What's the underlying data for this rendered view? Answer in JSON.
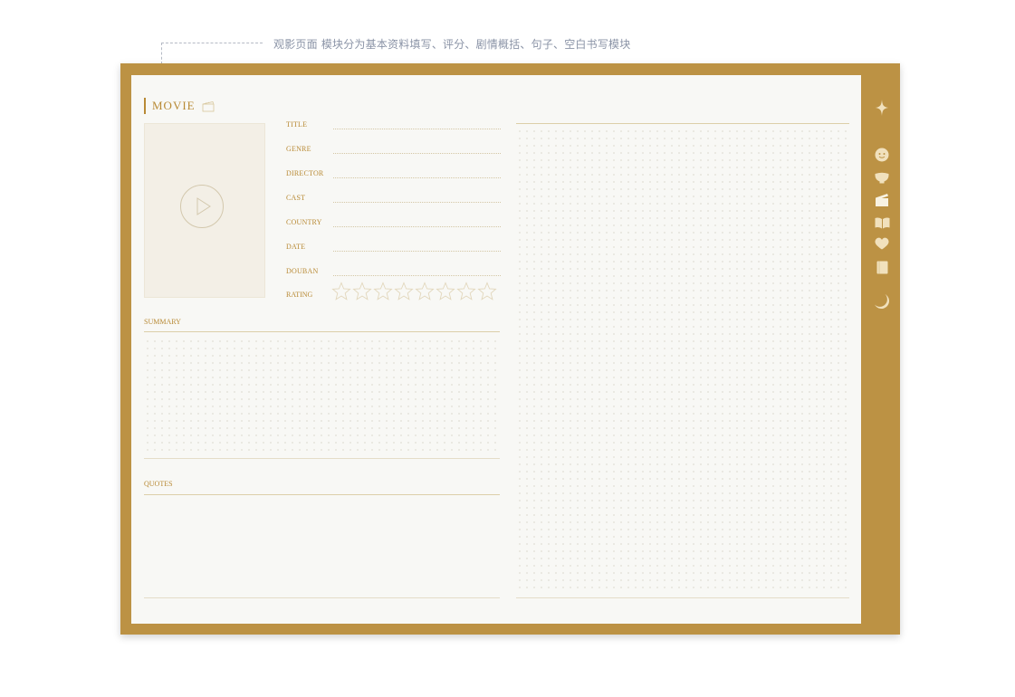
{
  "annotation": {
    "text": "观影页面 模块分为基本资料填写、评分、剧情概括、句子、空白书写模块"
  },
  "header": {
    "title": "MOVIE",
    "icon": "clapperboard-icon"
  },
  "poster": {
    "icon": "play-circle-icon"
  },
  "fields": [
    {
      "label": "TITLE",
      "value": ""
    },
    {
      "label": "GENRE",
      "value": ""
    },
    {
      "label": "DIRECTOR",
      "value": ""
    },
    {
      "label": "CAST",
      "value": ""
    },
    {
      "label": "COUNTRY",
      "value": ""
    },
    {
      "label": "DATE",
      "value": ""
    },
    {
      "label": "DOUBAN",
      "value": ""
    }
  ],
  "rating": {
    "label": "RATING",
    "max": 8,
    "value": 0
  },
  "summary": {
    "label": "SUMMARY"
  },
  "quotes": {
    "label": "QUOTES"
  },
  "side_nav": {
    "items": [
      {
        "icon": "sparkle-icon"
      },
      {
        "icon": "smiley-icon"
      },
      {
        "icon": "bowl-icon"
      },
      {
        "icon": "clapperboard-icon"
      },
      {
        "icon": "open-book-icon"
      },
      {
        "icon": "heart-icon"
      },
      {
        "icon": "notebook-icon"
      },
      {
        "icon": "moon-icon"
      }
    ]
  },
  "colors": {
    "frame": "#bc9244",
    "paper": "#f8f8f5",
    "accent": "#b88a35",
    "nav_icon": "#f1e1bd"
  }
}
